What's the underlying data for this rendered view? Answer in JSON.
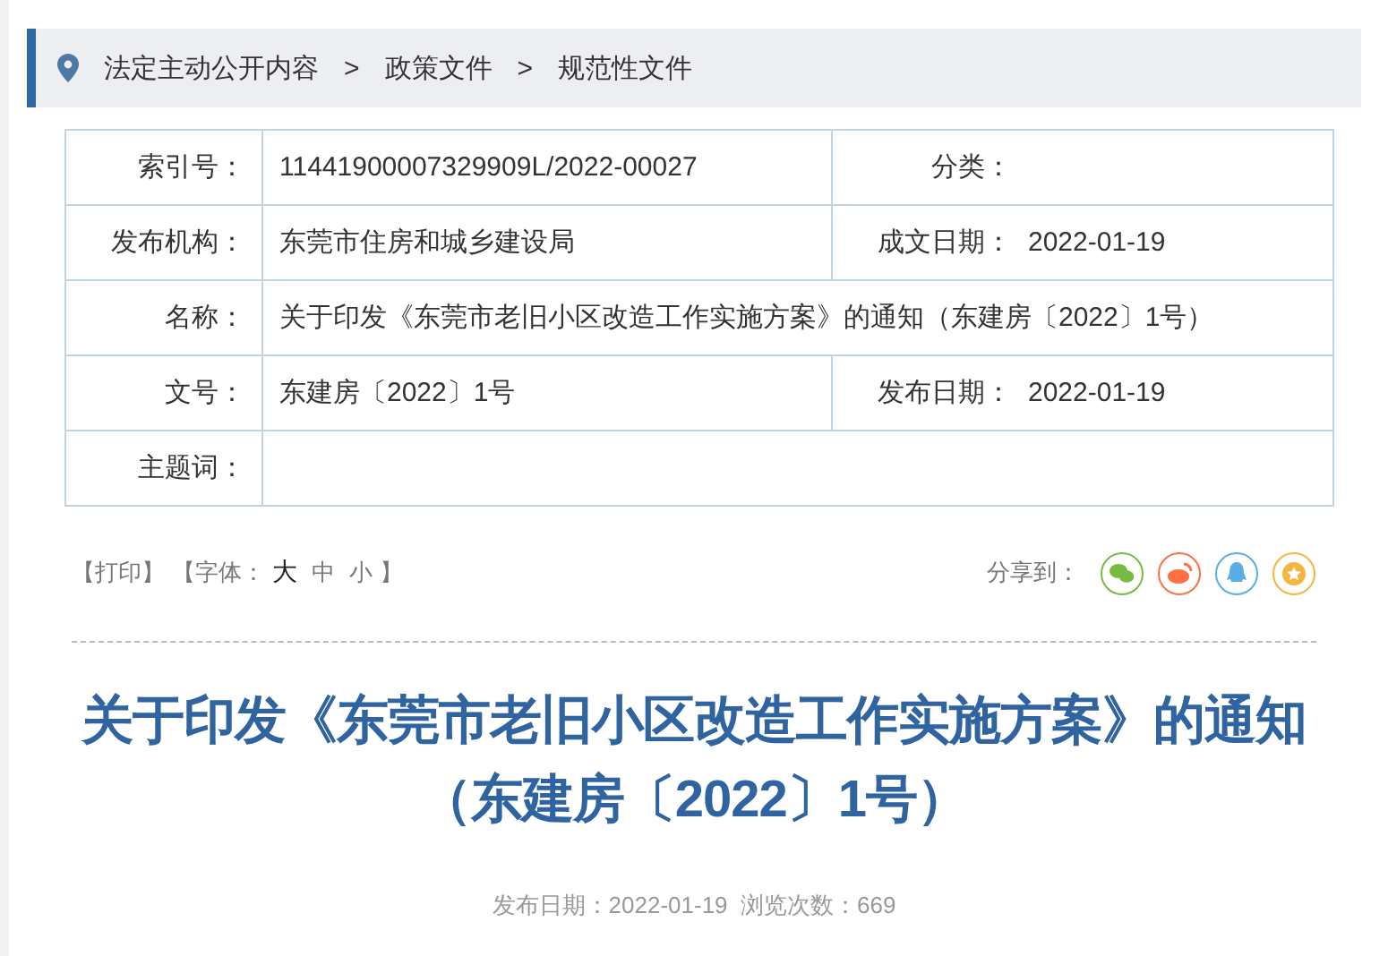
{
  "breadcrumb": [
    "法定主动公开内容",
    "政策文件",
    "规范性文件"
  ],
  "breadcrumb_separator": ">",
  "info": [
    {
      "label": "索引号：",
      "value": "11441900007329909L/2022-00027",
      "label2": "分类："
    },
    {
      "label": "发布机构：",
      "value": "东莞市住房和城乡建设局",
      "label2": "成文日期：",
      "value2": "2022-01-19"
    },
    {
      "label": "名称：",
      "value": "关于印发《东莞市老旧小区改造工作实施方案》的通知（东建房〔2022〕1号）"
    },
    {
      "label": "文号：",
      "value": "东建房〔2022〕1号",
      "label2": "发布日期：",
      "value2": "2022-01-19"
    },
    {
      "label": "主题词："
    }
  ],
  "print": "【打印】",
  "font_label": "【字体：",
  "font_sizes": [
    {
      "label": "大",
      "selected": true
    },
    {
      "label": "中",
      "selected": false
    },
    {
      "label": "小",
      "selected": false
    }
  ],
  "font_end": "】",
  "share_label": "分享到：",
  "share": [
    {
      "kind": "wechat",
      "color": "#77bb44"
    },
    {
      "kind": "weibo",
      "color": "#ff7043"
    },
    {
      "kind": "qq",
      "color": "#5aaee8"
    },
    {
      "kind": "star",
      "color": "#f5b540"
    }
  ],
  "title": "关于印发《东莞市老旧小区改造工作实施方案》的通知（东建房〔2022〕1号）",
  "meta": "发布日期：2022-01-19  浏览次数：669"
}
